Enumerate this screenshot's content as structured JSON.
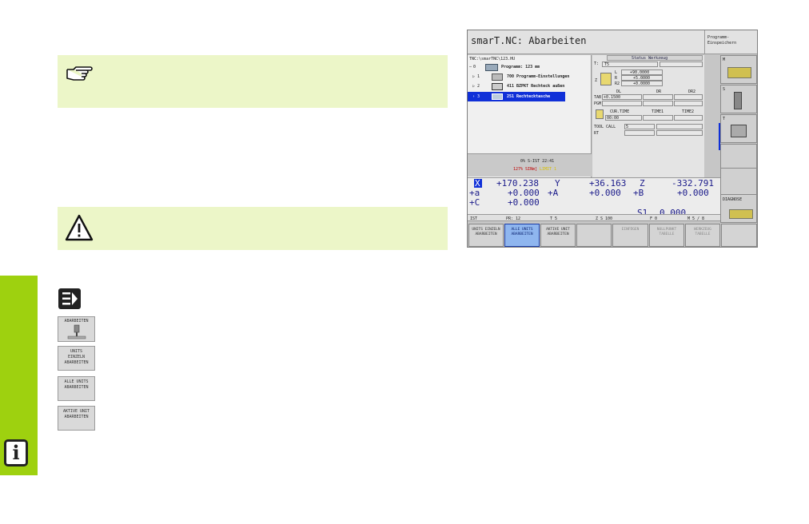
{
  "page": {
    "notes": [
      {
        "icon": "pointing-hand-icon"
      },
      {
        "icon": "warning-icon"
      }
    ],
    "left_tab_icon": "info-icon",
    "smarT_icon": "smarT-icon",
    "softkey_icons": [
      {
        "label": "ABARBEITEN",
        "icon": "abarbeiten-icon"
      },
      {
        "label": "UNITS EINZELN ABARBEITEN"
      },
      {
        "label": "ALLE UNITS ABARBEITEN"
      },
      {
        "label": "AKTIVE UNIT ABARBEITEN"
      }
    ]
  },
  "screen": {
    "title": "smarT.NC: Abarbeiten",
    "title_right": "Programm-Einspeichern",
    "path": "TNC:\\smarTNC\\123.HU",
    "tree": [
      {
        "num": "0",
        "text": "Programm: 123 mm"
      },
      {
        "num": "1",
        "text": "700 Programm-Einstellungen"
      },
      {
        "num": "2",
        "text": "411 BZPKT Rechteck außen"
      },
      {
        "num": "3",
        "text": "251 Rechtecktasche"
      }
    ],
    "status_title": "Status Werkzeug",
    "status": {
      "t_label": "T:",
      "t_value": "T5",
      "z_label": "Z",
      "l_label": "L",
      "l_value": "+90.0000",
      "r_label": "R",
      "r_value": "+5.0000",
      "r2_label": "R2",
      "r2_value": "+0.0000",
      "dl": "DL",
      "dr": "DR",
      "dr2": "DR2",
      "tab_label": "TAB",
      "tab_value": "+0.1500",
      "pgm_label": "PGM",
      "cur_time": "CUR.TIME",
      "time1": "TIME1",
      "time2": "TIME2",
      "cur_time_value": "00:00",
      "tool_call": "TOOL CALL",
      "tool_call_value": "5",
      "rt": "RT"
    },
    "progress": {
      "line1": "0% S-IST 22:41",
      "line2_red": "127% SINm]",
      "line2_yellow": "LIMIT 1"
    },
    "positions": [
      {
        "axis": "X",
        "value": "+170.238"
      },
      {
        "axis": "Y",
        "value": "+36.163"
      },
      {
        "axis": "Z",
        "value": "-332.791"
      },
      {
        "axis": "+a",
        "value": "+0.000"
      },
      {
        "axis": "+A",
        "value": "+0.000"
      },
      {
        "axis": "+B",
        "value": "+0.000"
      },
      {
        "axis": "+C",
        "value": "+0.000"
      }
    ],
    "spindle": {
      "label": "S1",
      "value": "0.000"
    },
    "status_bar": {
      "ist": "IST",
      "pr": "PR: 12",
      "t": "T 5",
      "zs": "Z S 100",
      "f": "F 0",
      "m": "M 5 / 8"
    },
    "softkeys": [
      {
        "label": "UNITS EINZELN ABARBEITEN"
      },
      {
        "label": "ALLE UNITS ABARBEITEN"
      },
      {
        "label": "AKTIVE UNIT ABARBEITEN"
      },
      {
        "label": ""
      },
      {
        "label": "EINFÜGEN"
      },
      {
        "label": "NULLPUNKT TABELLE"
      },
      {
        "label": "WERKZEUG TABELLE"
      },
      {
        "label": ""
      }
    ],
    "side_softkeys": [
      {
        "letter": "M"
      },
      {
        "letter": "S"
      },
      {
        "letter": "T"
      },
      {
        "letter": ""
      },
      {
        "letter": ""
      },
      {
        "letter": "DIAGNOSE"
      }
    ]
  }
}
